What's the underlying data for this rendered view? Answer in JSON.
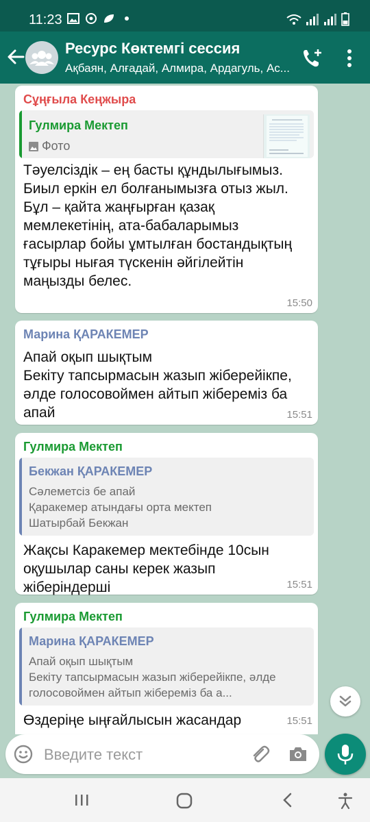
{
  "status_bar": {
    "time": "11:23"
  },
  "header": {
    "title": "Ресурс Көктемгі сессия",
    "subtitle": "Ақбаян, Алғадай, Алмира, Ардагуль, Ас..."
  },
  "colors": {
    "header_bg": "#0c6e60",
    "status_bg": "#0c5a4f",
    "chat_bg": "#b7d3c6",
    "accent_green": "#0c8c78"
  },
  "messages": [
    {
      "sender": "Сұңғыла Кеңжыра",
      "sender_color": "#e04c4c",
      "quote": {
        "name": "Гулмира Мектеп",
        "name_color": "#1a9a32",
        "text": "Фото",
        "icon": "photo-icon"
      },
      "text": "Тәуелсіздік – ең басты құндылығымыз. Биыл еркін ел болғанымызға отыз жыл. Бұл – қайта жаңғырған қазақ мемлекетінің, ата-бабаларымыз ғасырлар бойы ұмтылған бостандықтың тұғыры нығая түскенін әйгілейтін маңызды белес.",
      "time": "15:50"
    },
    {
      "sender": "Марина ҚАРАКЕМЕР",
      "sender_color": "#6d84b4",
      "text": "Апай оқып шықтым\nБекіту тапсырмасын жазып жіберейікпе, әлде голосовоймен айтып жібереміз ба апай",
      "time": "15:51"
    },
    {
      "sender": "Гулмира Мектеп",
      "sender_color": "#1a9a32",
      "quote": {
        "name": "Бекжан ҚАРАКЕМЕР",
        "name_color": "#6d84b4",
        "text": "Сәлеметсіз бе апай\nҚаракемер атындағы орта мектеп\nШатырбай Бекжан"
      },
      "text": "Жақсы Каракемер мектебінде 10сын оқушылар саны керек жазып жіберіндерші",
      "time": "15:51"
    },
    {
      "sender": "Гулмира Мектеп",
      "sender_color": "#1a9a32",
      "quote": {
        "name": "Марина ҚАРАКЕМЕР",
        "name_color": "#6d84b4",
        "text": "Апай оқып шықтым\nБекіту тапсырмасын жазып  жіберейікпе, әлде голосовоймен айтып жібереміз ба а..."
      },
      "text": "Өздеріңе ыңғайлысын жасандар",
      "time": "15:51"
    }
  ],
  "input": {
    "placeholder": "Введите текст"
  }
}
